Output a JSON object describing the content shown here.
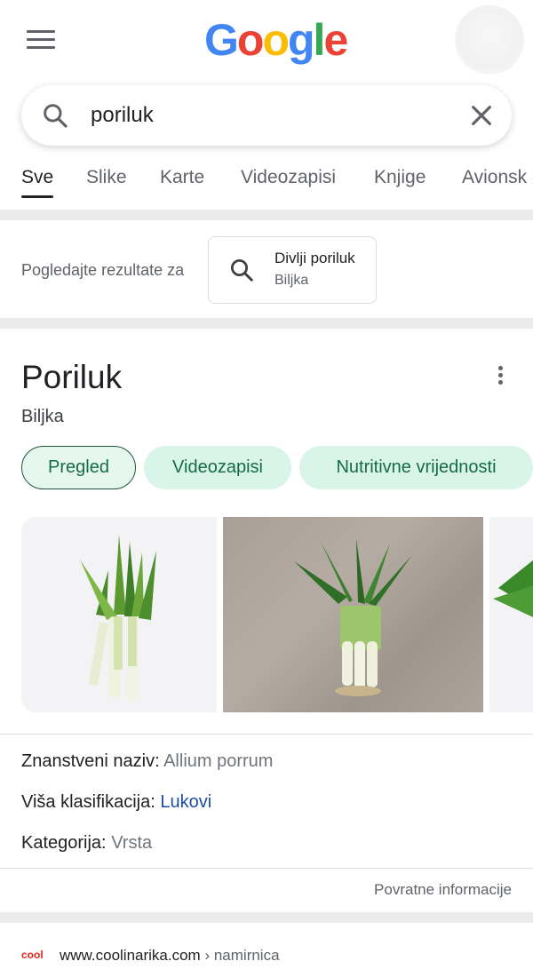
{
  "header": {
    "logo_letters": [
      "G",
      "o",
      "o",
      "g",
      "l",
      "e"
    ],
    "brand_colors": {
      "blue": "#4285F4",
      "red": "#EA4335",
      "yellow": "#FBBC05",
      "green": "#34A853"
    }
  },
  "search": {
    "query": "poriluk"
  },
  "tabs": [
    {
      "label": "Sve",
      "active": true
    },
    {
      "label": "Slike"
    },
    {
      "label": "Karte"
    },
    {
      "label": "Videozapisi"
    },
    {
      "label": "Knjige"
    },
    {
      "label": "Avionsk"
    }
  ],
  "suggestion": {
    "label": "Pogledajte rezultate za",
    "title": "Divlji poriluk",
    "subtitle": "Biljka"
  },
  "knowledge_panel": {
    "title": "Poriluk",
    "subtitle": "Biljka",
    "chips": [
      "Pregled",
      "Videozapisi",
      "Nutritivne vrijednosti"
    ],
    "facts": [
      {
        "label": "Znanstveni naziv:",
        "value": "Allium porrum"
      },
      {
        "label": "Viša klasifikacija:",
        "value": "Lukovi"
      },
      {
        "label": "Kategorija:",
        "value": "Vrsta"
      }
    ],
    "feedback": "Povratne informacije"
  },
  "result": {
    "favicon_text": "cool",
    "domain": "www.coolinarika.com",
    "breadcrumb": " › namirnica"
  }
}
